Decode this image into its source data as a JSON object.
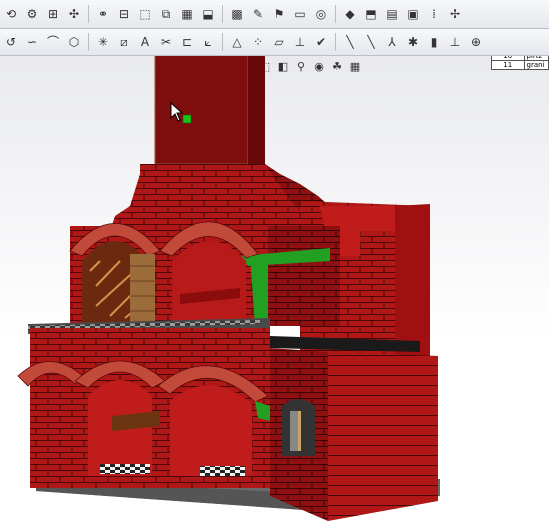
{
  "toolbar_top": {
    "buttons": [
      {
        "name": "select-icon",
        "glyph": "⟲"
      },
      {
        "name": "dimension-icon",
        "glyph": "⚙"
      },
      {
        "name": "smart-mates-icon",
        "glyph": "⊞"
      },
      {
        "name": "move-component-icon",
        "glyph": "✣"
      },
      {
        "name": "assembly-features-icon",
        "glyph": "⚭"
      },
      {
        "name": "mate-icon",
        "glyph": "⊟"
      },
      {
        "name": "linear-pattern-icon",
        "glyph": "⬚"
      },
      {
        "name": "exploded-view-icon",
        "glyph": "⧉"
      },
      {
        "name": "bom-icon",
        "glyph": "▦"
      },
      {
        "name": "interference-icon",
        "glyph": "⬓"
      },
      {
        "name": "show-hidden-icon",
        "glyph": "▩"
      },
      {
        "name": "rebuild-icon",
        "glyph": "✎"
      },
      {
        "name": "options-icon",
        "glyph": "⚑"
      },
      {
        "name": "sketch-icon",
        "glyph": "▭"
      },
      {
        "name": "smart-dimension-icon",
        "glyph": "◎"
      },
      {
        "name": "display-style-icon",
        "glyph": "◆"
      },
      {
        "name": "view-orientation-icon",
        "glyph": "⬒"
      },
      {
        "name": "section-view-icon",
        "glyph": "▤"
      },
      {
        "name": "hide-show-icon",
        "glyph": "▣"
      },
      {
        "name": "grid-icon",
        "glyph": "⁞"
      },
      {
        "name": "reference-geometry-icon",
        "glyph": "✢"
      }
    ]
  },
  "toolbar_second": {
    "buttons": [
      {
        "name": "arc-icon",
        "glyph": "↺"
      },
      {
        "name": "spline-icon",
        "glyph": "∽"
      },
      {
        "name": "fillet-icon",
        "glyph": "⌒"
      },
      {
        "name": "polygon-icon",
        "glyph": "⬡"
      },
      {
        "name": "point-icon",
        "glyph": "✳"
      },
      {
        "name": "mirror-icon",
        "glyph": "⧄"
      },
      {
        "name": "text-icon",
        "glyph": "A"
      },
      {
        "name": "trim-icon",
        "glyph": "✂"
      },
      {
        "name": "offset-icon",
        "glyph": "⊏"
      },
      {
        "name": "convert-entities-icon",
        "glyph": "⟀"
      },
      {
        "name": "extend-icon",
        "glyph": "△"
      },
      {
        "name": "pattern-icon",
        "glyph": "⁘"
      },
      {
        "name": "block-icon",
        "glyph": "▱"
      },
      {
        "name": "relations-icon",
        "glyph": "⊥"
      },
      {
        "name": "repair-sketch-icon",
        "glyph": "✔"
      },
      {
        "name": "line-icon",
        "glyph": "╲"
      },
      {
        "name": "centerline-icon",
        "glyph": "╲"
      },
      {
        "name": "axis-icon",
        "glyph": "⅄"
      },
      {
        "name": "point-sketch-icon",
        "glyph": "✱"
      },
      {
        "name": "plane-icon",
        "glyph": "▮"
      },
      {
        "name": "coordinate-icon",
        "glyph": "⊥"
      },
      {
        "name": "origin-icon",
        "glyph": "⊕"
      }
    ]
  },
  "headsup": {
    "buttons": [
      {
        "name": "zoom-to-fit-icon",
        "glyph": "🔍"
      },
      {
        "name": "zoom-area-icon",
        "glyph": "🔎"
      },
      {
        "name": "previous-view-icon",
        "glyph": "↶"
      },
      {
        "name": "section-view-icon",
        "glyph": "▣"
      },
      {
        "name": "view-orientation-icon",
        "glyph": "⬚"
      },
      {
        "name": "display-style-icon",
        "glyph": "◧"
      },
      {
        "name": "hide-show-items-icon",
        "glyph": "⚲"
      },
      {
        "name": "edit-appearance-icon",
        "glyph": "◉"
      },
      {
        "name": "apply-scene-icon",
        "glyph": "☘"
      },
      {
        "name": "view-settings-icon",
        "glyph": "▦"
      }
    ]
  },
  "bom_table": {
    "rows": [
      {
        "item": "10",
        "part": "pirtz"
      },
      {
        "item": "11",
        "part": "grani"
      }
    ]
  },
  "colors": {
    "brick": "#b01818",
    "brick_dark": "#7a0b0b",
    "mortar": "#3a0606",
    "arch_brick": "#c14a3a",
    "green_trim": "#22a022",
    "base": "#555555"
  }
}
